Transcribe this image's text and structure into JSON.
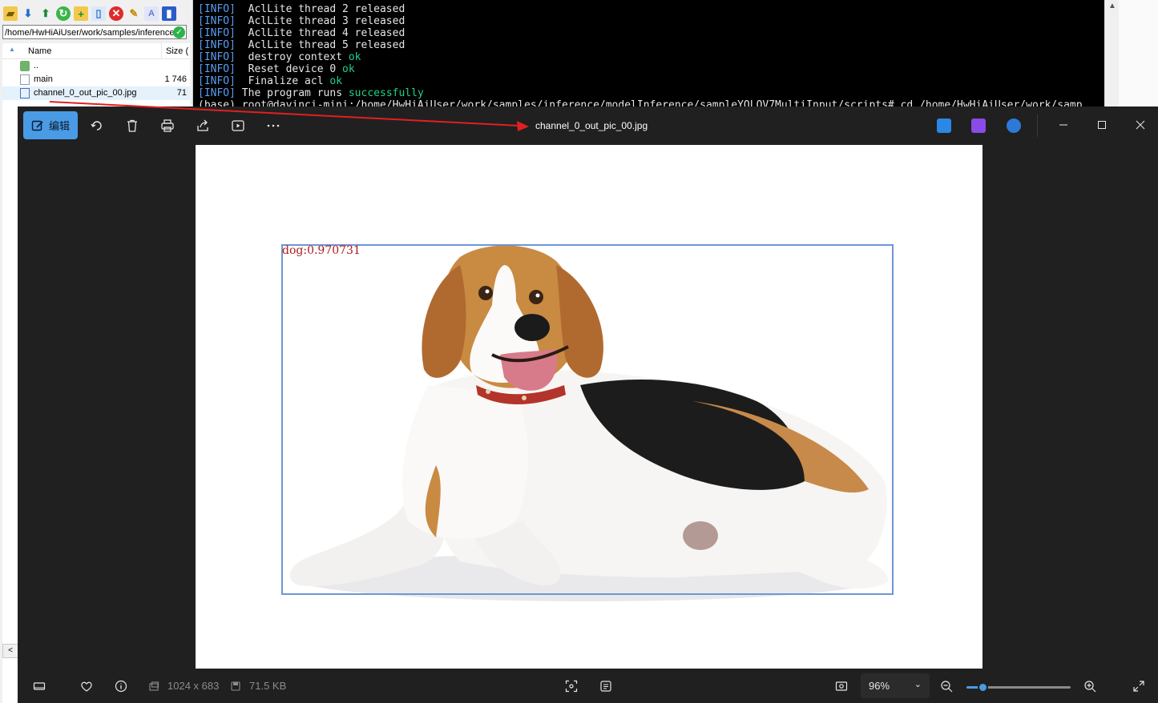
{
  "file_manager": {
    "toolbar_icons": [
      "open-folder-icon",
      "download-icon",
      "upload-icon",
      "refresh-icon",
      "new-folder-icon",
      "new-file-icon",
      "delete-icon",
      "properties-icon",
      "rename-icon",
      "bookmark-icon"
    ],
    "path": "/home/HwHiAiUser/work/samples/inference",
    "columns": {
      "name": "Name",
      "size": "Size ("
    },
    "rows": [
      {
        "name": "..",
        "size": "",
        "icon": "parent-folder-icon"
      },
      {
        "name": "main",
        "size": "1 746",
        "icon": "file-icon"
      },
      {
        "name": "channel_0_out_pic_00.jpg",
        "size": "71",
        "icon": "image-file-icon"
      }
    ],
    "hscroll_left": "<"
  },
  "terminal": {
    "lines": [
      {
        "tag": "[INFO]",
        "text": "  AclLite thread 2 released",
        "ok": ""
      },
      {
        "tag": "[INFO]",
        "text": "  AclLite thread 3 released",
        "ok": ""
      },
      {
        "tag": "[INFO]",
        "text": "  AclLite thread 4 released",
        "ok": ""
      },
      {
        "tag": "[INFO]",
        "text": "  AclLite thread 5 released",
        "ok": ""
      },
      {
        "tag": "[INFO]",
        "text": "  destroy context ",
        "ok": "ok"
      },
      {
        "tag": "[INFO]",
        "text": "  Reset device 0 ",
        "ok": "ok"
      },
      {
        "tag": "[INFO]",
        "text": "  Finalize acl ",
        "ok": "ok"
      },
      {
        "tag": "[INFO]",
        "text": " The program runs ",
        "ok": "successfully"
      }
    ],
    "prompt": "(base) root@davinci-mini:/home/HwHiAiUser/work/samples/inference/modelInference/sampleYOLOV7MultiInput/scripts# cd /home/HwHiAiUser/work/samp"
  },
  "viewer": {
    "edit_label": "编辑",
    "title": "channel_0_out_pic_00.jpg",
    "detection_label": "dog:0.970731",
    "image_dimensions": "1024 x 683",
    "file_size": "71.5 KB",
    "zoom": "96%",
    "zoom_fraction": 0.15,
    "colors": {
      "accent": "#4a9be6",
      "box": "#6f96d6",
      "label": "#b01818",
      "annotation_arrow": "#e02020"
    }
  }
}
